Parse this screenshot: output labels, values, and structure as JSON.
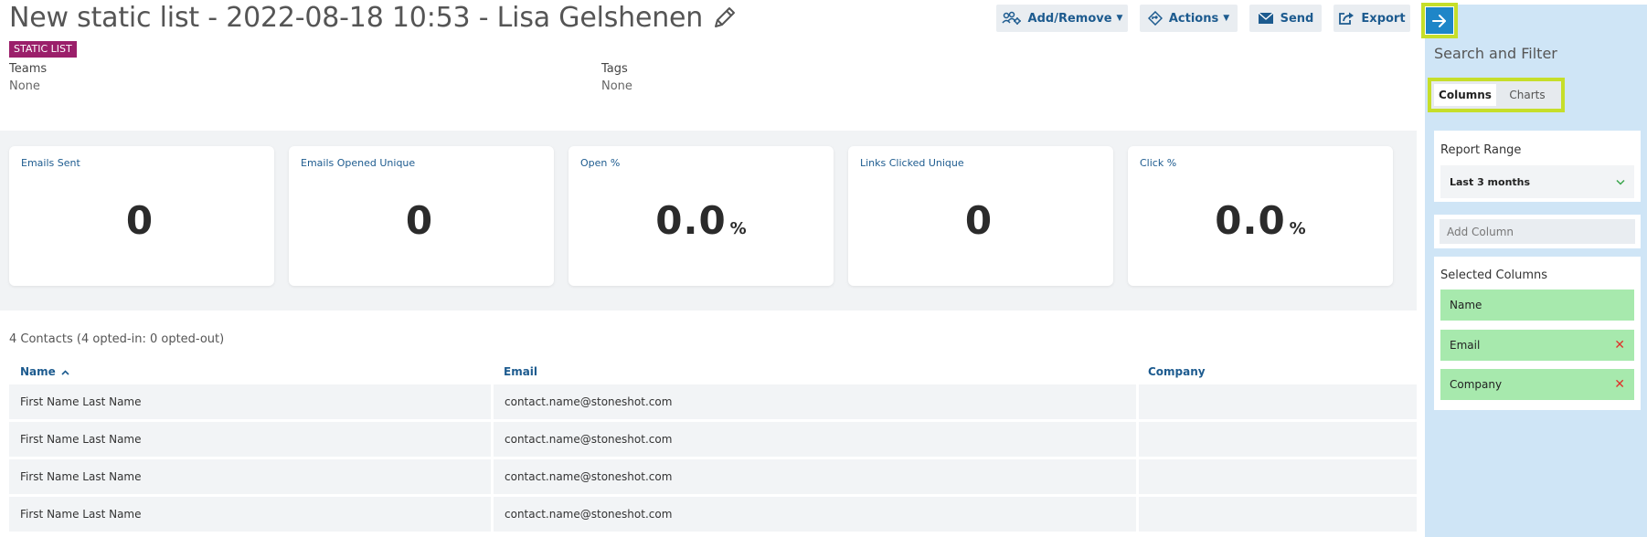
{
  "header": {
    "title": "New static list - 2022-08-18 10:53 - Lisa Gelshenen",
    "badge": "STATIC LIST",
    "teams_label": "Teams",
    "teams_value": "None",
    "tags_label": "Tags",
    "tags_value": "None"
  },
  "toolbar": {
    "add_remove": "Add/Remove",
    "actions": "Actions",
    "send": "Send",
    "export": "Export"
  },
  "stats": [
    {
      "label": "Emails Sent",
      "value": "0",
      "unit": ""
    },
    {
      "label": "Emails Opened Unique",
      "value": "0",
      "unit": ""
    },
    {
      "label": "Open %",
      "value": "0.0",
      "unit": "%"
    },
    {
      "label": "Links Clicked Unique",
      "value": "0",
      "unit": ""
    },
    {
      "label": "Click %",
      "value": "0.0",
      "unit": "%"
    }
  ],
  "contacts": {
    "summary": "4 Contacts (4 opted-in: 0 opted-out)",
    "columns": [
      "Name",
      "Email",
      "Company"
    ],
    "rows": [
      [
        "First Name Last Name",
        "contact.name@stoneshot.com",
        ""
      ],
      [
        "First Name Last Name",
        "contact.name@stoneshot.com",
        ""
      ],
      [
        "First Name Last Name",
        "contact.name@stoneshot.com",
        ""
      ],
      [
        "First Name Last Name",
        "contact.name@stoneshot.com",
        ""
      ]
    ]
  },
  "sidebar": {
    "title": "Search and Filter",
    "tabs": [
      "Columns",
      "Charts"
    ],
    "report_range_label": "Report Range",
    "report_range_value": "Last 3 months",
    "add_column_placeholder": "Add Column",
    "selected_columns_label": "Selected Columns",
    "selected_columns": [
      "Name",
      "Email",
      "Company"
    ]
  },
  "colors": {
    "accent": "#1d5b8f",
    "badge": "#9b1f6a",
    "highlight": "#c6de2a",
    "selected_column": "#a7e9ad",
    "remove": "#e0312b"
  }
}
